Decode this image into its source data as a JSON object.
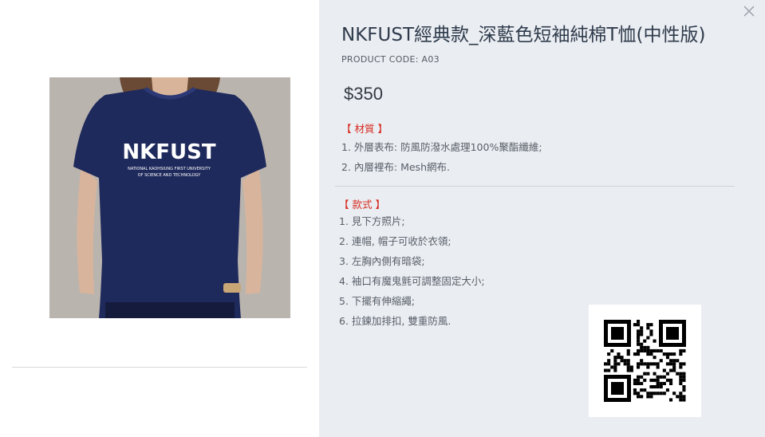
{
  "product": {
    "title": "NKFUST經典款_深藍色短袖純棉T恤(中性版)",
    "code_label": "PRODUCT CODE: A03",
    "price": "$350",
    "image_shirt_text_main": "NKFUST",
    "image_shirt_text_sub1": "NATIONAL KAOHSIUNG FIRST UNIVERSITY",
    "image_shirt_text_sub2": "OF SCIENCE AND TECHNOLOGY"
  },
  "material": {
    "heading": "【 材質 】",
    "items": [
      "1. 外層表布: 防風防潑水處理100%聚酯纖維;",
      "2. 內層裡布: Mesh網布."
    ]
  },
  "style": {
    "heading": "【 款式 】",
    "items": [
      "1. 見下方照片;",
      "2. 連帽, 帽子可收於衣領;",
      "3. 左胸內側有暗袋;",
      "4. 袖口有魔鬼氈可調整固定大小;",
      "5. 下擺有伸縮繩;",
      "6. 拉鍊加排扣, 雙重防風."
    ]
  },
  "icons": {
    "close": "close-icon",
    "qr": "qr-code-image"
  },
  "colors": {
    "panel_bg": "#eaedf1",
    "accent_red": "#d6271d",
    "shirt_navy": "#1f2a5c"
  }
}
